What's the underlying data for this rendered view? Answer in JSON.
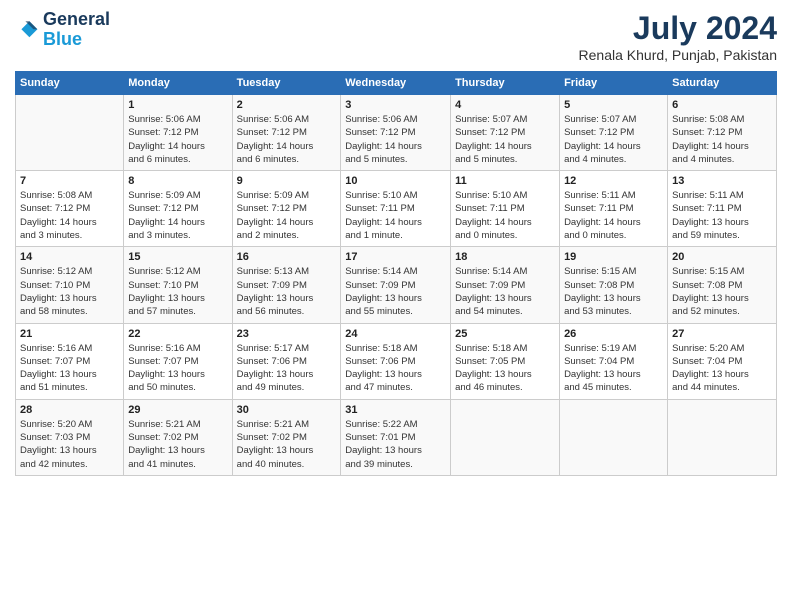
{
  "header": {
    "logo_line1": "General",
    "logo_line2": "Blue",
    "month_title": "July 2024",
    "subtitle": "Renala Khurd, Punjab, Pakistan"
  },
  "days_header": [
    "Sunday",
    "Monday",
    "Tuesday",
    "Wednesday",
    "Thursday",
    "Friday",
    "Saturday"
  ],
  "weeks": [
    [
      {
        "day": "",
        "info": ""
      },
      {
        "day": "1",
        "info": "Sunrise: 5:06 AM\nSunset: 7:12 PM\nDaylight: 14 hours\nand 6 minutes."
      },
      {
        "day": "2",
        "info": "Sunrise: 5:06 AM\nSunset: 7:12 PM\nDaylight: 14 hours\nand 6 minutes."
      },
      {
        "day": "3",
        "info": "Sunrise: 5:06 AM\nSunset: 7:12 PM\nDaylight: 14 hours\nand 5 minutes."
      },
      {
        "day": "4",
        "info": "Sunrise: 5:07 AM\nSunset: 7:12 PM\nDaylight: 14 hours\nand 5 minutes."
      },
      {
        "day": "5",
        "info": "Sunrise: 5:07 AM\nSunset: 7:12 PM\nDaylight: 14 hours\nand 4 minutes."
      },
      {
        "day": "6",
        "info": "Sunrise: 5:08 AM\nSunset: 7:12 PM\nDaylight: 14 hours\nand 4 minutes."
      }
    ],
    [
      {
        "day": "7",
        "info": "Sunrise: 5:08 AM\nSunset: 7:12 PM\nDaylight: 14 hours\nand 3 minutes."
      },
      {
        "day": "8",
        "info": "Sunrise: 5:09 AM\nSunset: 7:12 PM\nDaylight: 14 hours\nand 3 minutes."
      },
      {
        "day": "9",
        "info": "Sunrise: 5:09 AM\nSunset: 7:12 PM\nDaylight: 14 hours\nand 2 minutes."
      },
      {
        "day": "10",
        "info": "Sunrise: 5:10 AM\nSunset: 7:11 PM\nDaylight: 14 hours\nand 1 minute."
      },
      {
        "day": "11",
        "info": "Sunrise: 5:10 AM\nSunset: 7:11 PM\nDaylight: 14 hours\nand 0 minutes."
      },
      {
        "day": "12",
        "info": "Sunrise: 5:11 AM\nSunset: 7:11 PM\nDaylight: 14 hours\nand 0 minutes."
      },
      {
        "day": "13",
        "info": "Sunrise: 5:11 AM\nSunset: 7:11 PM\nDaylight: 13 hours\nand 59 minutes."
      }
    ],
    [
      {
        "day": "14",
        "info": "Sunrise: 5:12 AM\nSunset: 7:10 PM\nDaylight: 13 hours\nand 58 minutes."
      },
      {
        "day": "15",
        "info": "Sunrise: 5:12 AM\nSunset: 7:10 PM\nDaylight: 13 hours\nand 57 minutes."
      },
      {
        "day": "16",
        "info": "Sunrise: 5:13 AM\nSunset: 7:09 PM\nDaylight: 13 hours\nand 56 minutes."
      },
      {
        "day": "17",
        "info": "Sunrise: 5:14 AM\nSunset: 7:09 PM\nDaylight: 13 hours\nand 55 minutes."
      },
      {
        "day": "18",
        "info": "Sunrise: 5:14 AM\nSunset: 7:09 PM\nDaylight: 13 hours\nand 54 minutes."
      },
      {
        "day": "19",
        "info": "Sunrise: 5:15 AM\nSunset: 7:08 PM\nDaylight: 13 hours\nand 53 minutes."
      },
      {
        "day": "20",
        "info": "Sunrise: 5:15 AM\nSunset: 7:08 PM\nDaylight: 13 hours\nand 52 minutes."
      }
    ],
    [
      {
        "day": "21",
        "info": "Sunrise: 5:16 AM\nSunset: 7:07 PM\nDaylight: 13 hours\nand 51 minutes."
      },
      {
        "day": "22",
        "info": "Sunrise: 5:16 AM\nSunset: 7:07 PM\nDaylight: 13 hours\nand 50 minutes."
      },
      {
        "day": "23",
        "info": "Sunrise: 5:17 AM\nSunset: 7:06 PM\nDaylight: 13 hours\nand 49 minutes."
      },
      {
        "day": "24",
        "info": "Sunrise: 5:18 AM\nSunset: 7:06 PM\nDaylight: 13 hours\nand 47 minutes."
      },
      {
        "day": "25",
        "info": "Sunrise: 5:18 AM\nSunset: 7:05 PM\nDaylight: 13 hours\nand 46 minutes."
      },
      {
        "day": "26",
        "info": "Sunrise: 5:19 AM\nSunset: 7:04 PM\nDaylight: 13 hours\nand 45 minutes."
      },
      {
        "day": "27",
        "info": "Sunrise: 5:20 AM\nSunset: 7:04 PM\nDaylight: 13 hours\nand 44 minutes."
      }
    ],
    [
      {
        "day": "28",
        "info": "Sunrise: 5:20 AM\nSunset: 7:03 PM\nDaylight: 13 hours\nand 42 minutes."
      },
      {
        "day": "29",
        "info": "Sunrise: 5:21 AM\nSunset: 7:02 PM\nDaylight: 13 hours\nand 41 minutes."
      },
      {
        "day": "30",
        "info": "Sunrise: 5:21 AM\nSunset: 7:02 PM\nDaylight: 13 hours\nand 40 minutes."
      },
      {
        "day": "31",
        "info": "Sunrise: 5:22 AM\nSunset: 7:01 PM\nDaylight: 13 hours\nand 39 minutes."
      },
      {
        "day": "",
        "info": ""
      },
      {
        "day": "",
        "info": ""
      },
      {
        "day": "",
        "info": ""
      }
    ]
  ]
}
